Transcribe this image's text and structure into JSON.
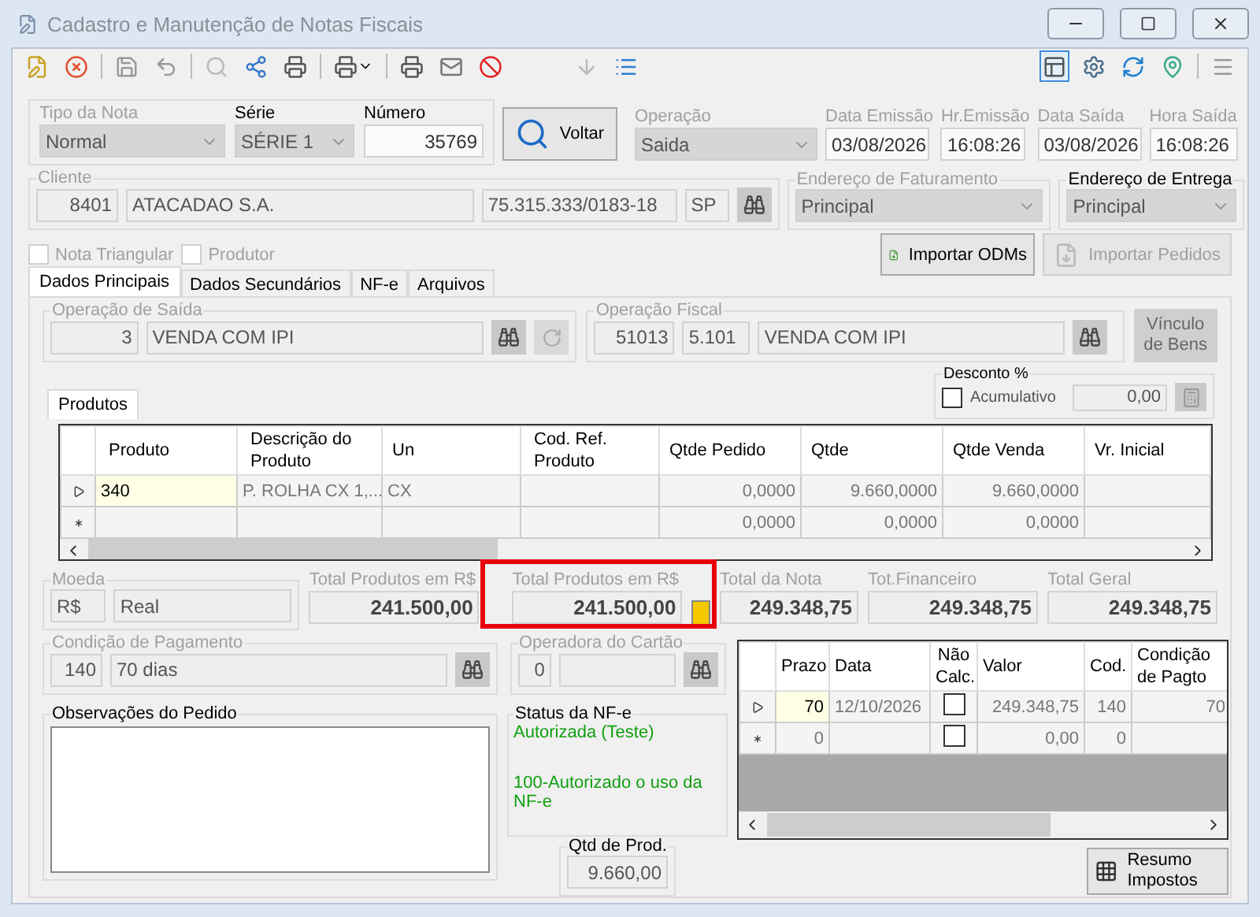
{
  "window": {
    "title": "Cadastro e Manutenção de Notas Fiscais"
  },
  "header": {
    "fields": [
      {
        "kind": "combo",
        "label": "Tipo da Nota",
        "value": "Normal",
        "disabled": true
      },
      {
        "kind": "combo",
        "label": "Série",
        "value": "SÉRIE 1",
        "disabled": false
      },
      {
        "kind": "text",
        "label": "Número",
        "value": "35769",
        "disabled": false
      }
    ],
    "voltar_button": "Voltar",
    "operacao": {
      "label": "Operação",
      "value": "Saida"
    },
    "dates": [
      {
        "label": "Data Emissão",
        "value": "03/08/2026"
      },
      {
        "label": "Hr.Emissão",
        "value": "16:08:26"
      },
      {
        "label": "Data Saída",
        "value": "03/08/2026"
      },
      {
        "label": "Hora Saída",
        "value": "16:08:26"
      }
    ]
  },
  "cliente": {
    "label": "Cliente",
    "code": "8401",
    "name": "ATACADAO S.A.",
    "cnpj": "75.315.333/0183-18",
    "uf": "SP"
  },
  "enderecos": [
    {
      "label": "Endereço de Faturamento",
      "value": "Principal",
      "disabled": true
    },
    {
      "label": "Endereço de Entrega",
      "value": "Principal",
      "disabled": false
    }
  ],
  "options": [
    {
      "label": "Nota Triangular",
      "checked": false
    },
    {
      "label": "Produtor",
      "checked": false
    }
  ],
  "import_buttons": [
    {
      "label": "Importar ODMs",
      "disabled": false
    },
    {
      "label": "Importar Pedidos",
      "disabled": true
    }
  ],
  "tabs": [
    {
      "label": "Dados Principais",
      "selected": true
    },
    {
      "label": "Dados Secundários",
      "selected": false
    },
    {
      "label": "NF-e",
      "selected": false
    },
    {
      "label": "Arquivos",
      "selected": false
    }
  ],
  "operacao_saida": {
    "label": "Operação de Saída",
    "code": "3",
    "name": "VENDA COM IPI"
  },
  "operacao_fiscal": {
    "label": "Operação Fiscal",
    "code": "51013",
    "cfop": "5.101",
    "name": "VENDA COM IPI"
  },
  "vinculo_button": "Vínculo de Bens",
  "desconto": {
    "label": "Desconto %",
    "checkbox_label": "Acumulativo",
    "checked": false,
    "value": "0,00"
  },
  "products": {
    "tab": "Produtos",
    "columns": [
      "Produto",
      "Descrição do Produto",
      "Un",
      "Cod. Ref. Produto",
      "Qtde Pedido",
      "Qtde",
      "Qtde Venda",
      "Vr. Inicial"
    ],
    "rows": [
      {
        "kind": "current",
        "cells": [
          "340",
          "P. ROLHA CX 1,...",
          "CX",
          null,
          "0,0000",
          "9.660,0000",
          "9.660,0000",
          null
        ]
      },
      {
        "kind": "new",
        "cells": [
          null,
          null,
          null,
          null,
          "0,0000",
          "0,0000",
          "0,0000",
          null
        ]
      }
    ]
  },
  "moeda": {
    "label": "Moeda",
    "code": "R$",
    "name": "Real"
  },
  "totals": [
    {
      "label": "Total Produtos em R$",
      "value": "241.500,00"
    },
    {
      "label": "Total Produtos em R$",
      "value": "241.500,00"
    },
    {
      "label": "Total da Nota",
      "value": "249.348,75"
    },
    {
      "label": "Tot.Financeiro",
      "value": "249.348,75"
    },
    {
      "label": "Total Geral",
      "value": "249.348,75"
    }
  ],
  "condicao": {
    "label": "Condição de Pagamento",
    "code": "140",
    "name": "70 dias"
  },
  "operadora": {
    "label": "Operadora do Cartão",
    "code": "0"
  },
  "observacoes": {
    "label": "Observações do Pedido"
  },
  "status": {
    "label": "Status da NF-e",
    "lines": [
      "Autorizada (Teste)",
      "100-Autorizado o uso da NF-e"
    ]
  },
  "qtd_prod": {
    "label": "Qtd de Prod.",
    "value": "9.660,00"
  },
  "payments": {
    "columns": [
      "Prazo",
      "Data",
      "Não Calc.",
      "Valor",
      "Cod.",
      "Condição de Pagto"
    ],
    "rows": [
      {
        "kind": "current",
        "prazo": "70",
        "data": "12/10/2026",
        "nao_calc": false,
        "valor": "249.348,75",
        "cod": "140",
        "condicao": "70"
      },
      {
        "kind": "new",
        "prazo": "0",
        "nao_calc": false,
        "valor": "0,00",
        "cod": "0"
      }
    ]
  },
  "resumo_button": "Resumo Impostos"
}
